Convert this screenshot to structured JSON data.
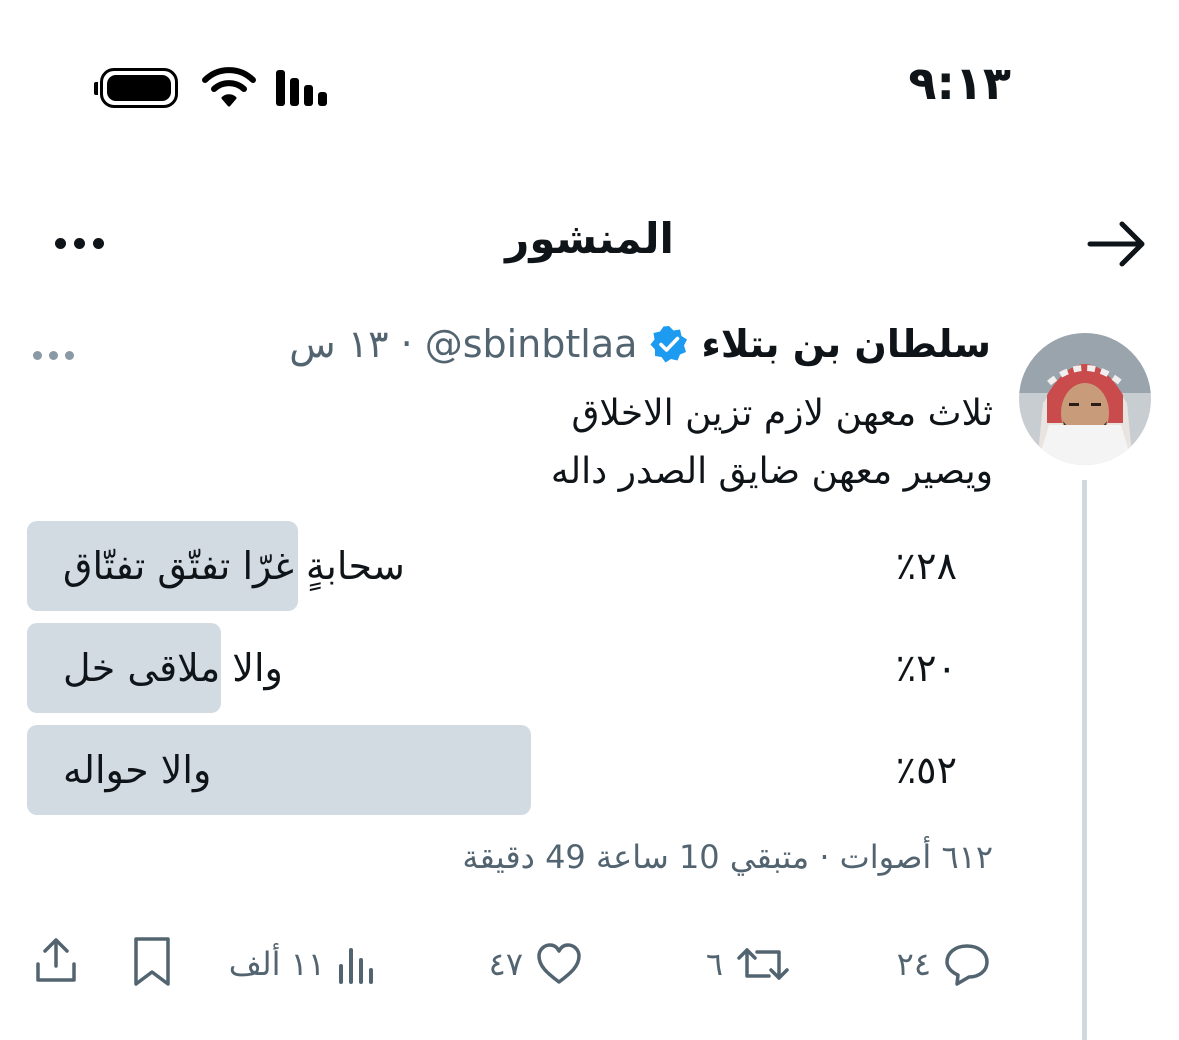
{
  "status_bar": {
    "time": "٩:١٣"
  },
  "header": {
    "title": "المنشور"
  },
  "post": {
    "author_name": "سلطان بن بتلاء",
    "handle": "@sbinbtlaa",
    "separator": "·",
    "time_ago": "١٣ س",
    "text_line_1": "ثلاث معهن لازم تزين الاخلاق",
    "text_line_2": "ويصير معهن ضايق الصدر داله"
  },
  "poll": {
    "options": [
      {
        "label": "سحابةٍ غرّا تفتّق تفتّاق",
        "percent_text": "٢٨٪",
        "percent": 28
      },
      {
        "label": "والا ملاقى خل",
        "percent_text": "٢٠٪",
        "percent": 20
      },
      {
        "label": "والا حواله",
        "percent_text": "٥٢٪",
        "percent": 52
      }
    ],
    "meta": "٦١٢ أصوات · متبقي 10 ساعة 49 دقيقة"
  },
  "actions": {
    "replies": "٢٤",
    "reposts": "٦",
    "likes": "٤٧",
    "views": "١١ ألف"
  },
  "colors": {
    "text": "#0f1419",
    "secondary": "#536471",
    "verified": "#1d9bf0",
    "poll_bar": "#d2dbe1"
  },
  "icons": {
    "back": "arrow-right-icon",
    "more": "more-horizontal-icon",
    "verified": "verified-badge-icon",
    "reply": "reply-icon",
    "repost": "repost-icon",
    "like": "heart-icon",
    "views": "views-chart-icon",
    "bookmark": "bookmark-icon",
    "share": "share-icon"
  }
}
